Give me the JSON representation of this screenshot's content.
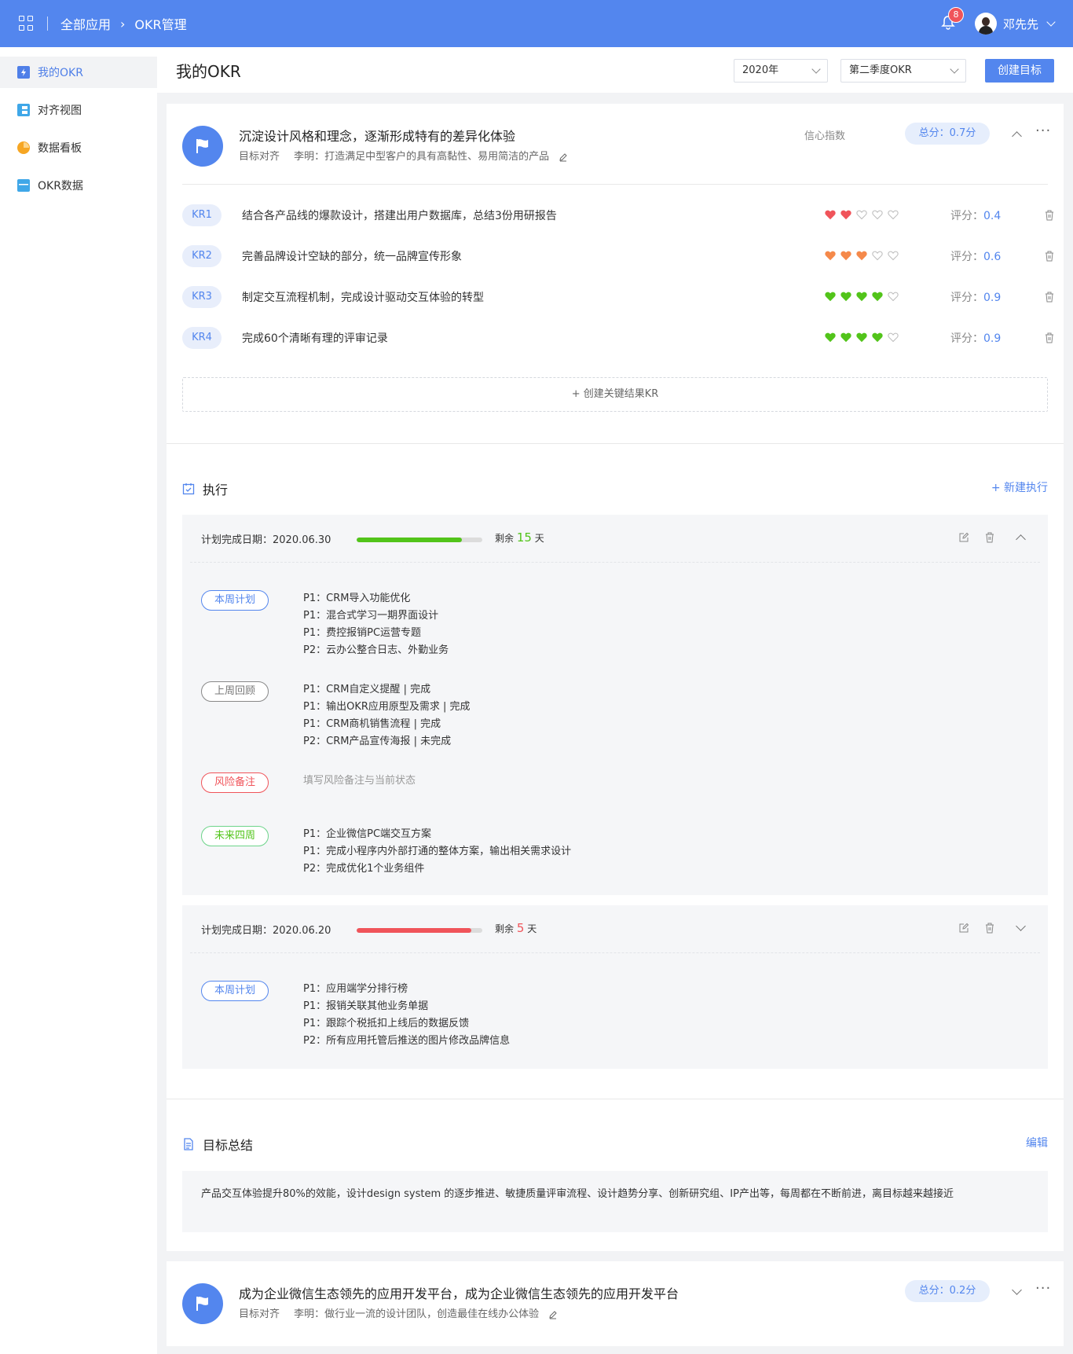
{
  "topbar": {
    "crumb_root": "全部应用",
    "crumb_current": "OKR管理",
    "notification_count": "8",
    "username": "邓先先"
  },
  "sidebar": {
    "items": [
      {
        "label": "我的OKR",
        "icon": "bolt-icon",
        "active": true
      },
      {
        "label": "对齐视图",
        "icon": "layout-icon",
        "active": false
      },
      {
        "label": "数据看板",
        "icon": "pie-chart-icon",
        "active": false
      },
      {
        "label": "OKR数据",
        "icon": "calendar-icon",
        "active": false
      }
    ]
  },
  "header": {
    "title": "我的OKR",
    "year_select": "2020年",
    "quarter_select": "第二季度OKR",
    "create_button": "创建目标"
  },
  "objective1": {
    "title": "沉淀设计风格和理念，逐渐形成特有的差异化体验",
    "align_label": "目标对齐",
    "align_text": "李明：打造满足中型客户的具有高黏性、易用简洁的产品",
    "confidence_label": "信心指数",
    "score": "总分：0.7分",
    "krs": [
      {
        "tag": "KR1",
        "text": "结合各产品线的爆款设计，搭建出用户数据库，总结3份用研报告",
        "hearts": 2,
        "color": "#f0545a",
        "score_label": "评分：",
        "score": "0.4"
      },
      {
        "tag": "KR2",
        "text": "完善品牌设计空缺的部分，统一品牌宣传形象",
        "hearts": 3,
        "color": "#f5894a",
        "score_label": "评分：",
        "score": "0.6"
      },
      {
        "tag": "KR3",
        "text": "制定交互流程机制，完成设计驱动交互体验的转型",
        "hearts": 4,
        "color": "#52c41a",
        "score_label": "评分：",
        "score": "0.9"
      },
      {
        "tag": "KR4",
        "text": "完成60个清晰有理的评审记录",
        "hearts": 4,
        "color": "#52c41a",
        "score_label": "评分：",
        "score": "0.9"
      }
    ],
    "add_kr": "+ 创建关键结果KR",
    "exec_title": "执行",
    "exec_new": "+ 新建执行",
    "exec1": {
      "date": "计划完成日期：2020.06.30",
      "progress": 0.84,
      "bar_color": "#52c41a",
      "remain_prefix": "剩余",
      "remain_days": "15",
      "remain_color": "#52c41a",
      "remain_suffix": "天",
      "this_week_tag": "本周计划",
      "this_week": [
        "P1：CRM导入功能优化",
        "P1：混合式学习一期界面设计",
        "P1：费控报销PC运营专题",
        "P2：云办公整合日志、外勤业务"
      ],
      "last_week_tag": "上周回顾",
      "last_week": [
        "P1：CRM自定义提醒 | 完成",
        "P1：输出OKR应用原型及需求 | 完成",
        "P1：CRM商机销售流程 | 完成",
        "P2：CRM产品宣传海报 | 未完成"
      ],
      "risk_tag": "风险备注",
      "risk_placeholder": "填写风险备注与当前状态",
      "future_tag": "未来四周",
      "future": [
        "P1：企业微信PC端交互方案",
        "P1：完成小程序内外部打通的整体方案，输出相关需求设计",
        "P2：完成优化1个业务组件"
      ]
    },
    "exec2": {
      "date": "计划完成日期：2020.06.20",
      "progress": 0.91,
      "bar_color": "#f0545a",
      "remain_prefix": "剩余",
      "remain_days": "5",
      "remain_color": "#f0545a",
      "remain_suffix": "天",
      "this_week_tag": "本周计划",
      "this_week": [
        "P1：应用端学分排行榜",
        "P1：报销关联其他业务单据",
        "P1：跟踪个税抵扣上线后的数据反馈",
        "P2：所有应用托管后推送的图片修改品牌信息"
      ]
    },
    "summary_title": "目标总结",
    "summary_edit": "编辑",
    "summary_text": "产品交互体验提升80%的效能，设计design system 的逐步推进、敏捷质量评审流程、设计趋势分享、创新研究组、IP产出等，每周都在不断前进，离目标越来越接近"
  },
  "objective2": {
    "title": "成为企业微信生态领先的应用开发平台，成为企业微信生态领先的应用开发平台",
    "align_label": "目标对齐",
    "align_text": "李明：做行业一流的设计团队，创造最佳在线办公体验",
    "score": "总分：0.2分"
  }
}
